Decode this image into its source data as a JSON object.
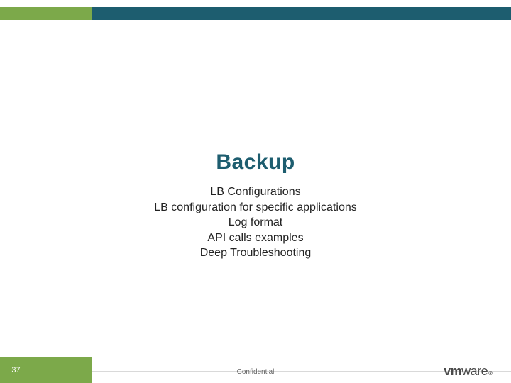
{
  "title": "Backup",
  "subtitles": {
    "line1": "LB Configurations",
    "line2": "LB configuration for specific applications",
    "line3": "Log format",
    "line4": "API calls examples",
    "line5": "Deep Troubleshooting"
  },
  "footer": {
    "page_number": "37",
    "confidential": "Confidential"
  },
  "logo": {
    "vm": "vm",
    "ware": "ware",
    "r": "®"
  },
  "colors": {
    "green": "#7ca94a",
    "teal": "#1d5d6f"
  }
}
